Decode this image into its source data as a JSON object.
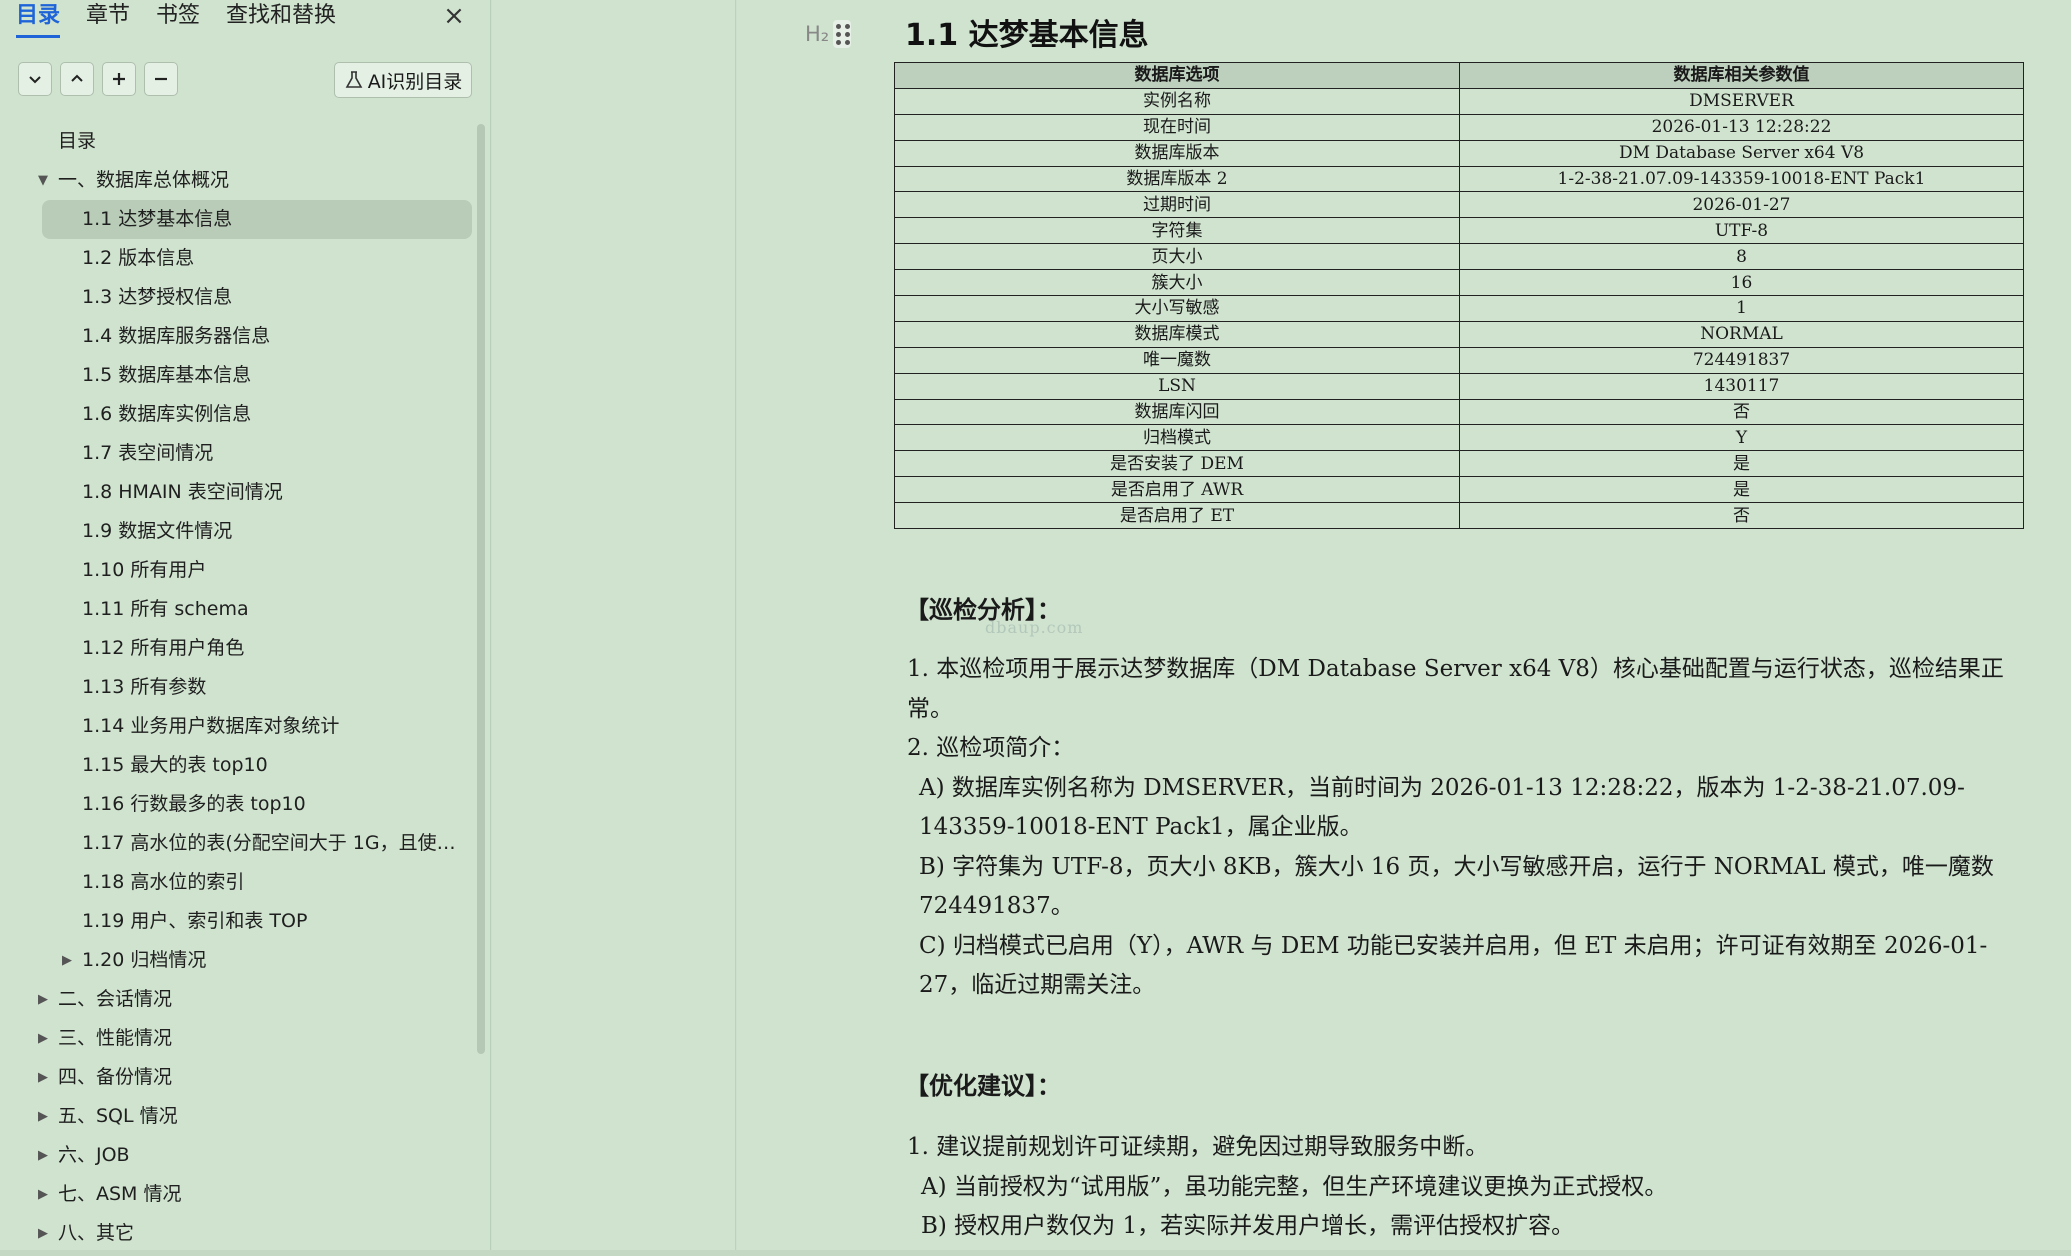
{
  "sidebar": {
    "tabs": [
      "目录",
      "章节",
      "书签",
      "查找和替换"
    ],
    "ai_button_label": "AI识别目录",
    "toc": [
      {
        "label": "目录",
        "level": 0,
        "arrow": ""
      },
      {
        "label": "一、数据库总体概况",
        "level": 0,
        "arrow": "▼"
      },
      {
        "label": "1.1 达梦基本信息",
        "level": 1,
        "arrow": "",
        "selected": true
      },
      {
        "label": "1.2 版本信息",
        "level": 1,
        "arrow": ""
      },
      {
        "label": "1.3 达梦授权信息",
        "level": 1,
        "arrow": ""
      },
      {
        "label": "1.4 数据库服务器信息",
        "level": 1,
        "arrow": ""
      },
      {
        "label": "1.5 数据库基本信息",
        "level": 1,
        "arrow": ""
      },
      {
        "label": "1.6 数据库实例信息",
        "level": 1,
        "arrow": ""
      },
      {
        "label": "1.7 表空间情况",
        "level": 1,
        "arrow": ""
      },
      {
        "label": "1.8 HMAIN 表空间情况",
        "level": 1,
        "arrow": ""
      },
      {
        "label": "1.9 数据文件情况",
        "level": 1,
        "arrow": ""
      },
      {
        "label": "1.10 所有用户",
        "level": 1,
        "arrow": ""
      },
      {
        "label": "1.11 所有 schema",
        "level": 1,
        "arrow": ""
      },
      {
        "label": "1.12 所有用户角色",
        "level": 1,
        "arrow": ""
      },
      {
        "label": "1.13 所有参数",
        "level": 1,
        "arrow": ""
      },
      {
        "label": "1.14 业务用户数据库对象统计",
        "level": 1,
        "arrow": ""
      },
      {
        "label": "1.15 最大的表 top10",
        "level": 1,
        "arrow": ""
      },
      {
        "label": "1.16 行数最多的表 top10",
        "level": 1,
        "arrow": ""
      },
      {
        "label": "1.17 高水位的表(分配空间大于 1G，且使用...",
        "level": 1,
        "arrow": ""
      },
      {
        "label": "1.18 高水位的索引",
        "level": 1,
        "arrow": ""
      },
      {
        "label": "1.19 用户、索引和表 TOP",
        "level": 1,
        "arrow": ""
      },
      {
        "label": "1.20 归档情况",
        "level": 1,
        "arrow": "▶"
      },
      {
        "label": "二、会话情况",
        "level": 0,
        "arrow": "▶"
      },
      {
        "label": "三、性能情况",
        "level": 0,
        "arrow": "▶"
      },
      {
        "label": "四、备份情况",
        "level": 0,
        "arrow": "▶"
      },
      {
        "label": "五、SQL 情况",
        "level": 0,
        "arrow": "▶"
      },
      {
        "label": "六、JOB",
        "level": 0,
        "arrow": "▶"
      },
      {
        "label": "七、ASM 情况",
        "level": 0,
        "arrow": "▶"
      },
      {
        "label": "八、其它",
        "level": 0,
        "arrow": "▶"
      }
    ]
  },
  "doc": {
    "h_marker": "H₂",
    "title": "1.1  达梦基本信息",
    "table": {
      "headers": [
        "数据库选项",
        "数据库相关参数值"
      ],
      "rows": [
        [
          "实例名称",
          "DMSERVER"
        ],
        [
          "现在时间",
          "2026-01-13 12:28:22"
        ],
        [
          "数据库版本",
          "DM Database Server x64 V8"
        ],
        [
          "数据库版本 2",
          "1-2-38-21.07.09-143359-10018-ENT  Pack1"
        ],
        [
          "过期时间",
          "2026-01-27"
        ],
        [
          "字符集",
          "UTF-8"
        ],
        [
          "页大小",
          "8"
        ],
        [
          "簇大小",
          "16"
        ],
        [
          "大小写敏感",
          "1"
        ],
        [
          "数据库模式",
          "NORMAL"
        ],
        [
          "唯一魔数",
          "724491837"
        ],
        [
          "LSN",
          "1430117"
        ],
        [
          "数据库闪回",
          "否"
        ],
        [
          "归档模式",
          "Y"
        ],
        [
          "是否安装了 DEM",
          "是"
        ],
        [
          "是否启用了 AWR",
          "是"
        ],
        [
          "是否启用了 ET",
          "否"
        ]
      ]
    },
    "analysis_heading": "【巡检分析】：",
    "watermark": "dbaup.com",
    "analysis": [
      {
        "text": "1. 本巡检项用于展示达梦数据库（DM Database Server x64 V8）核心基础配置与运行状态，巡检结果正常。",
        "indent": false
      },
      {
        "text": "2. 巡检项简介：",
        "indent": false
      },
      {
        "text": "A) 数据库实例名称为 DMSERVER，当前时间为 2026-01-13 12:28:22，版本为 1-2-38-21.07.09-143359-10018-ENT Pack1，属企业版。",
        "indent": true
      },
      {
        "text": "B) 字符集为 UTF-8，页大小 8KB，簇大小 16 页，大小写敏感开启，运行于 NORMAL 模式，唯一魔数 724491837。",
        "indent": true
      },
      {
        "text": "C) 归档模式已启用（Y），AWR 与 DEM 功能已安装并启用，但 ET 未启用；许可证有效期至 2026-01-27，临近过期需关注。",
        "indent": true
      }
    ],
    "suggest_heading": "【优化建议】：",
    "suggest": [
      {
        "text": "1. 建议提前规划许可证续期，避免因过期导致服务中断。",
        "indent": false
      },
      {
        "text": "A) 当前授权为“试用版”，虽功能完整，但生产环境建议更换为正式授权。",
        "indent": true
      },
      {
        "text": "B) 授权用户数仅为 1，若实际并发用户增长，需评估授权扩容。",
        "indent": true
      }
    ]
  }
}
